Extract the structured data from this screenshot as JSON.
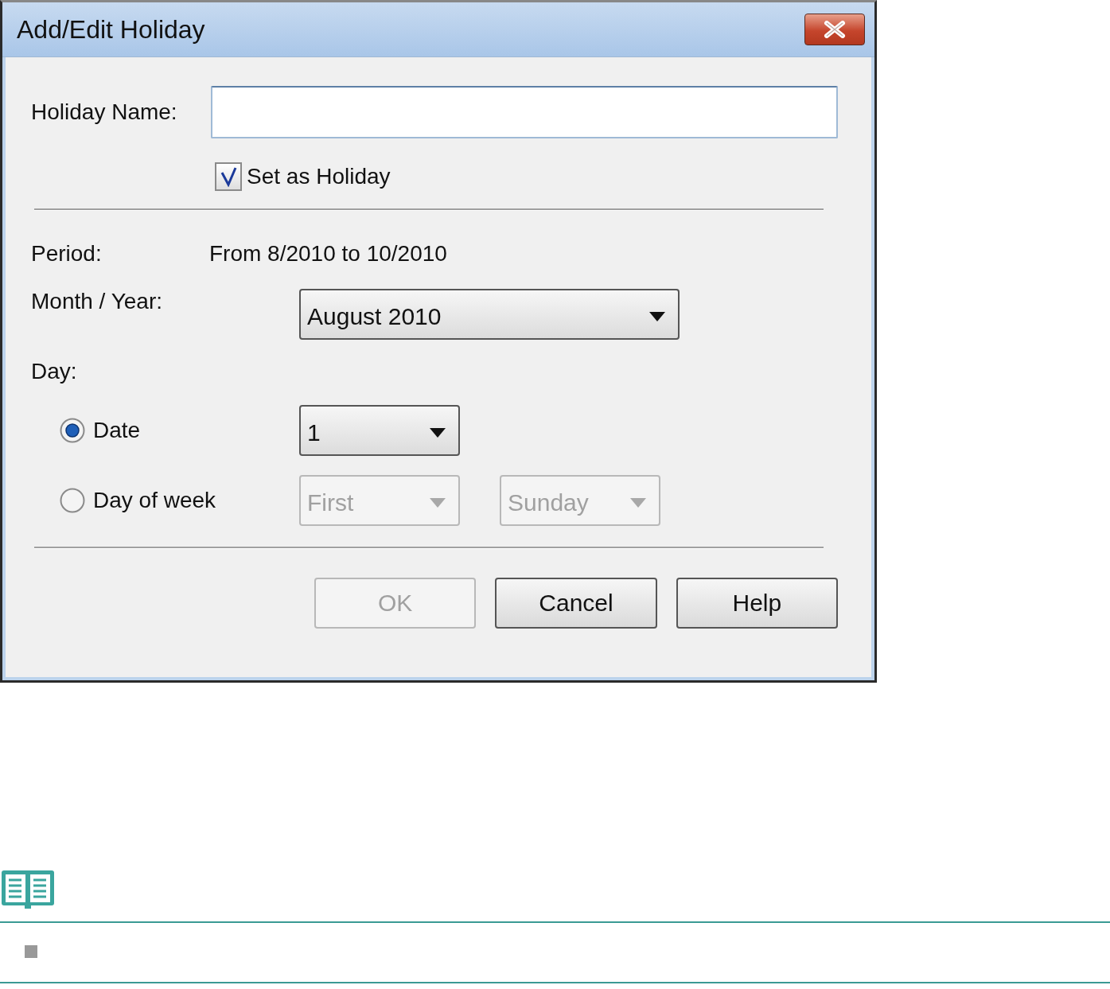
{
  "window": {
    "title": "Add/Edit Holiday"
  },
  "holiday_name": {
    "label": "Holiday Name:"
  },
  "set_as_holiday": {
    "label": "Set as Holiday",
    "checked": true
  },
  "period": {
    "label": "Period:",
    "value": "From 8/2010 to 10/2010"
  },
  "month_year": {
    "label": "Month / Year:",
    "value": "August 2010"
  },
  "day": {
    "label": "Day:",
    "options": [
      {
        "label": "Date",
        "selected": true,
        "dropdowns": [
          {
            "value": "1",
            "disabled": false
          }
        ]
      },
      {
        "label": "Day of week",
        "selected": false,
        "dropdowns": [
          {
            "value": "First",
            "disabled": true
          },
          {
            "value": "Sunday",
            "disabled": true
          }
        ]
      }
    ]
  },
  "buttons": [
    {
      "label": "OK",
      "disabled": true
    },
    {
      "label": "Cancel",
      "disabled": false
    },
    {
      "label": "Help",
      "disabled": false
    }
  ]
}
